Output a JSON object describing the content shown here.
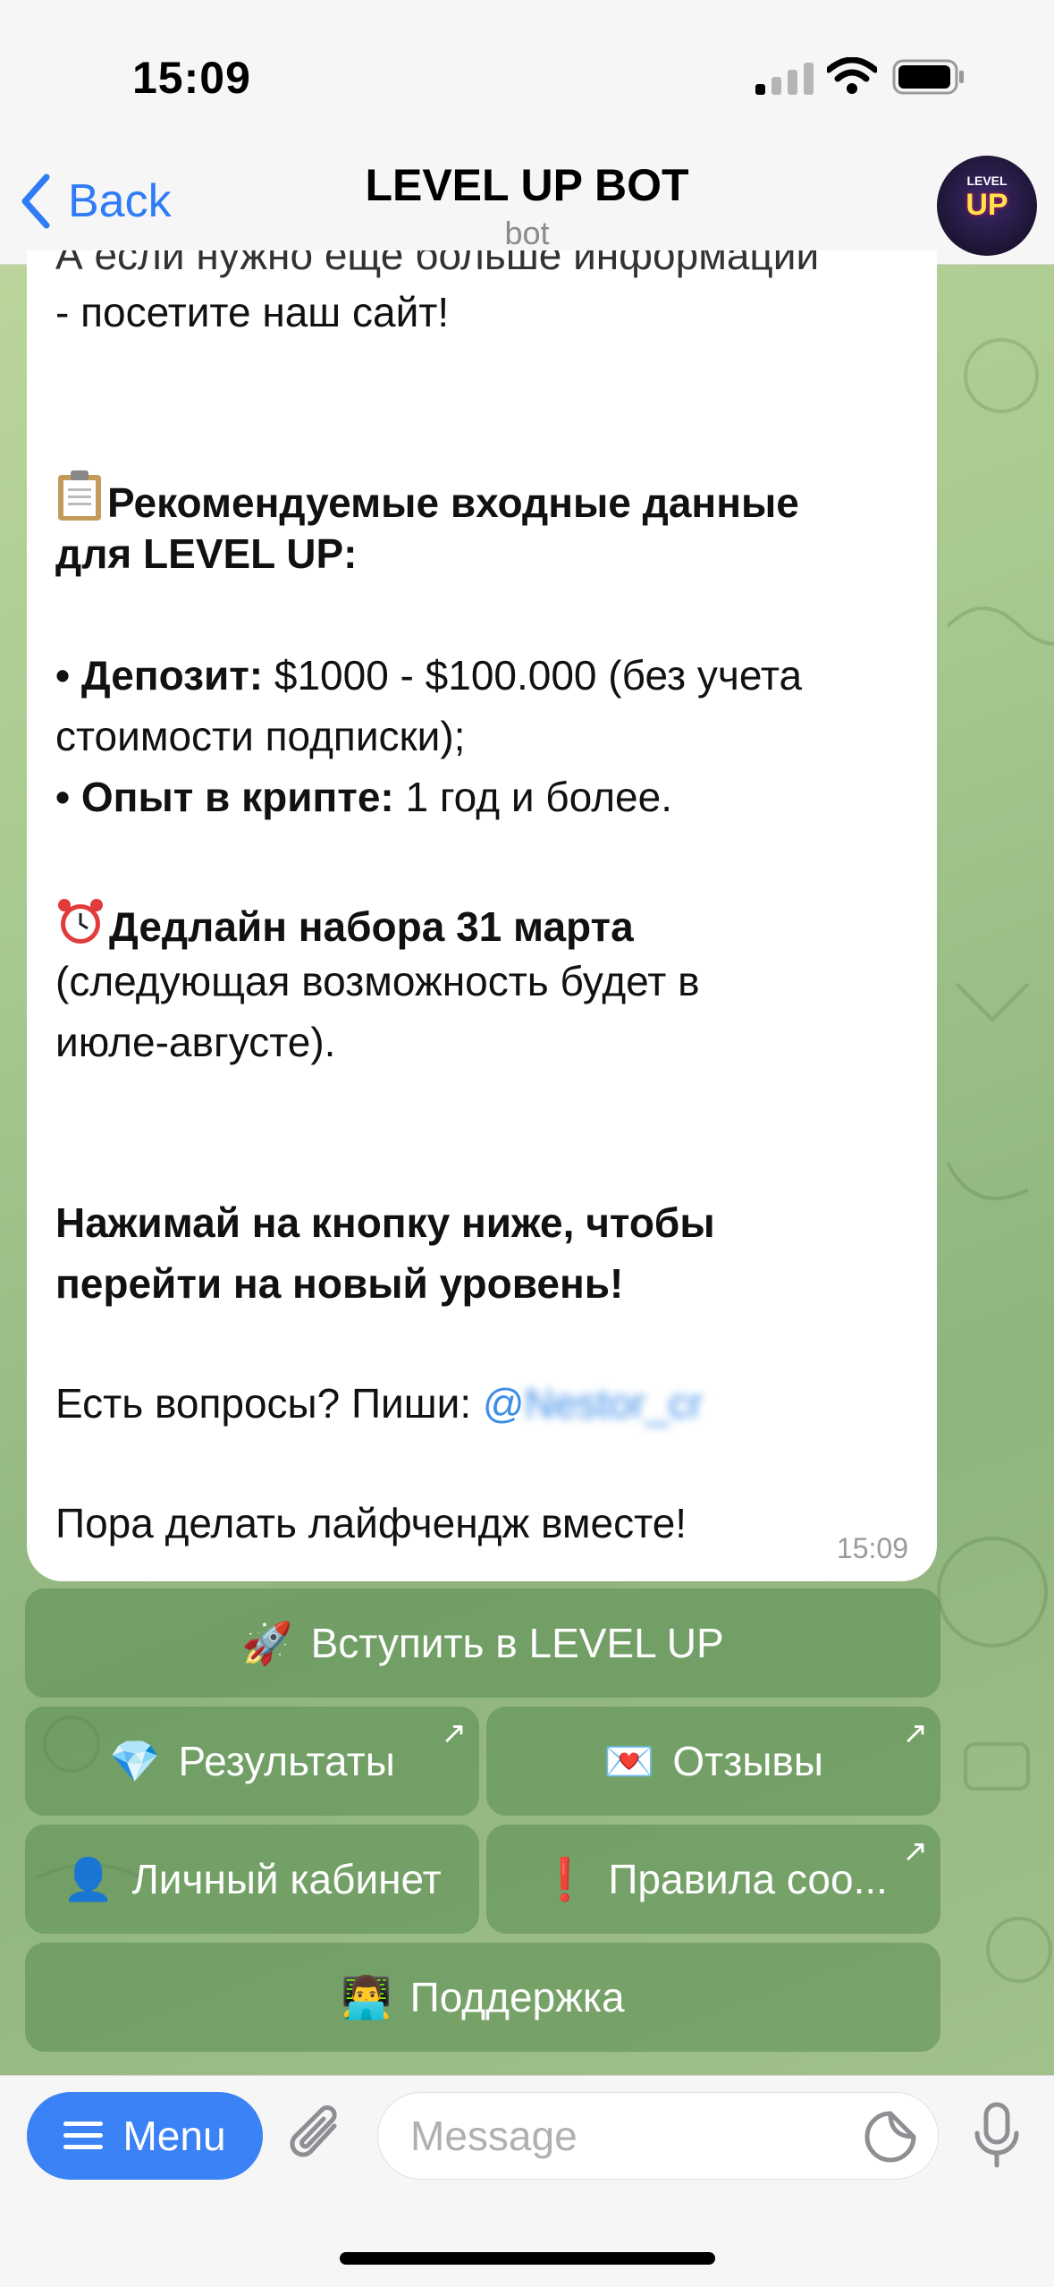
{
  "status": {
    "time": "15:09"
  },
  "nav": {
    "back_label": "Back",
    "title": "LEVEL UP BOT",
    "subtitle": "bot",
    "avatar_top": "LEVEL",
    "avatar_text": "UP"
  },
  "message": {
    "line_partial": "А если нужно еще больше информации",
    "line_site": "- посетите наш сайт!",
    "rec_title_1": "Рекомендуемые входные данные",
    "rec_title_2": "для LEVEL UP:",
    "deposit_label": "• Депозит:",
    "deposit_value": " $1000 - $100.000 (без учета",
    "deposit_value_2": "стоимости подписки);",
    "exp_label": "• Опыт в крипте:",
    "exp_value": " 1 год и более.",
    "deadline_title": "Дедлайн набора 31 марта",
    "deadline_1": "(следующая возможность будет в",
    "deadline_2": "июле-августе).",
    "cta_1": "Нажимай на кнопку ниже, чтобы",
    "cta_2": "перейти на новый уровень!",
    "questions": "Есть вопросы? Пиши: ",
    "mention_at": "@",
    "mention": "Nestor_cr",
    "closing": "Пора делать лайфчендж вместе!",
    "time": "15:09"
  },
  "keyboard": {
    "join": {
      "icon": "🚀",
      "label": "Вступить в LEVEL UP"
    },
    "results": {
      "icon": "💎",
      "label": "Результаты"
    },
    "reviews": {
      "icon": "💌",
      "label": "Отзывы"
    },
    "cabinet": {
      "icon": "👤",
      "label": "Личный кабинет"
    },
    "rules": {
      "icon": "❗",
      "label": "Правила соо..."
    },
    "support": {
      "icon": "👨‍💻",
      "label": "Поддержка"
    },
    "arrow_icon": "↗"
  },
  "input": {
    "menu_label": "Menu",
    "placeholder": "Message"
  },
  "colors": {
    "accent": "#3a82f6",
    "bubble": "#ffffff",
    "button_bg": "#6a9c5e"
  }
}
